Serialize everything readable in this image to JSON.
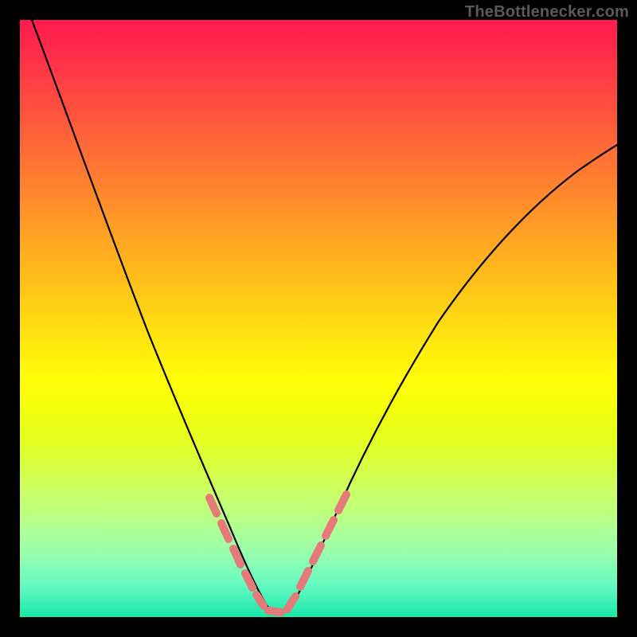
{
  "watermark": "TheBottlenecker.com",
  "chart_data": {
    "type": "line",
    "title": "",
    "xlabel": "",
    "ylabel": "",
    "xlim": [
      0,
      100
    ],
    "ylim": [
      0,
      100
    ],
    "note": "Axes have no visible tick labels; values are approximate pixel-derived positions normalized to 0–100. Curve represents a V-shaped bottleneck chart with minimum at roughly x≈40. Pink dashed segments overlay the flanks of the minimum.",
    "series": [
      {
        "name": "curve",
        "x": [
          2,
          5,
          8,
          11,
          14,
          17,
          20,
          23,
          26,
          29,
          32,
          35,
          37,
          39,
          41,
          43,
          45,
          47,
          50,
          55,
          60,
          65,
          70,
          75,
          80,
          85,
          90,
          95,
          100
        ],
        "y": [
          100,
          89,
          79,
          70,
          61,
          53,
          45,
          38,
          31,
          24.5,
          18,
          12,
          8,
          4.5,
          2,
          1.2,
          2.5,
          7,
          14,
          24,
          33.5,
          42,
          50,
          57,
          63,
          68.5,
          73,
          77,
          80
        ]
      },
      {
        "name": "highlight-left-dash",
        "x": [
          32,
          33.5,
          35,
          36.5,
          38,
          40,
          42,
          44
        ],
        "y": [
          18,
          15,
          12,
          9,
          6,
          3,
          1.5,
          1.5
        ]
      },
      {
        "name": "highlight-right-dash",
        "x": [
          46,
          48,
          50,
          52,
          54
        ],
        "y": [
          4,
          9,
          14,
          18,
          22
        ]
      }
    ],
    "colors": {
      "curve": "#000000",
      "highlight": "#e47a7a"
    },
    "gradient_stops": [
      {
        "pct": 0,
        "color": "#ff1a4f"
      },
      {
        "pct": 50,
        "color": "#ffe70f"
      },
      {
        "pct": 100,
        "color": "#17e8a8"
      }
    ]
  }
}
